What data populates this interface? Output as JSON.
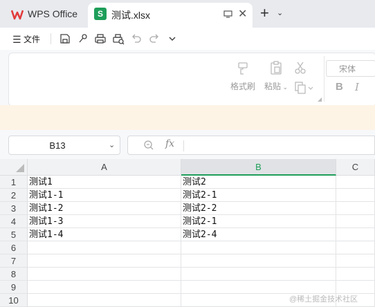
{
  "title_bar": {
    "tabs": [
      {
        "label": "WPS Office"
      },
      {
        "label": "测试.xlsx",
        "badge": "S"
      }
    ]
  },
  "toolbar": {
    "menu_label": "文件"
  },
  "ribbon": {
    "format_painter": "格式刷",
    "paste": "粘贴",
    "font_name": "宋体",
    "bold": "B",
    "italic": "I"
  },
  "formula_bar": {
    "cell_ref": "B13",
    "fx": "fx",
    "formula": ""
  },
  "sheet": {
    "columns": [
      "A",
      "B",
      "C"
    ],
    "selected_column": "B",
    "rows": [
      {
        "n": "1",
        "a": "测试1",
        "b": "测试2"
      },
      {
        "n": "2",
        "a": "测试1-1",
        "b": "测试2-1"
      },
      {
        "n": "3",
        "a": "测试1-2",
        "b": "测试2-2"
      },
      {
        "n": "4",
        "a": "测试1-3",
        "b": "测试2-1"
      },
      {
        "n": "5",
        "a": "测试1-4",
        "b": "测试2-4"
      },
      {
        "n": "6",
        "a": "",
        "b": ""
      },
      {
        "n": "7",
        "a": "",
        "b": ""
      },
      {
        "n": "8",
        "a": "",
        "b": ""
      },
      {
        "n": "9",
        "a": "",
        "b": ""
      },
      {
        "n": "10",
        "a": "",
        "b": ""
      }
    ]
  },
  "watermark": "@稀土掘金技术社区",
  "colors": {
    "accent_green": "#1e9e5a",
    "wps_red": "#e23b3b"
  }
}
